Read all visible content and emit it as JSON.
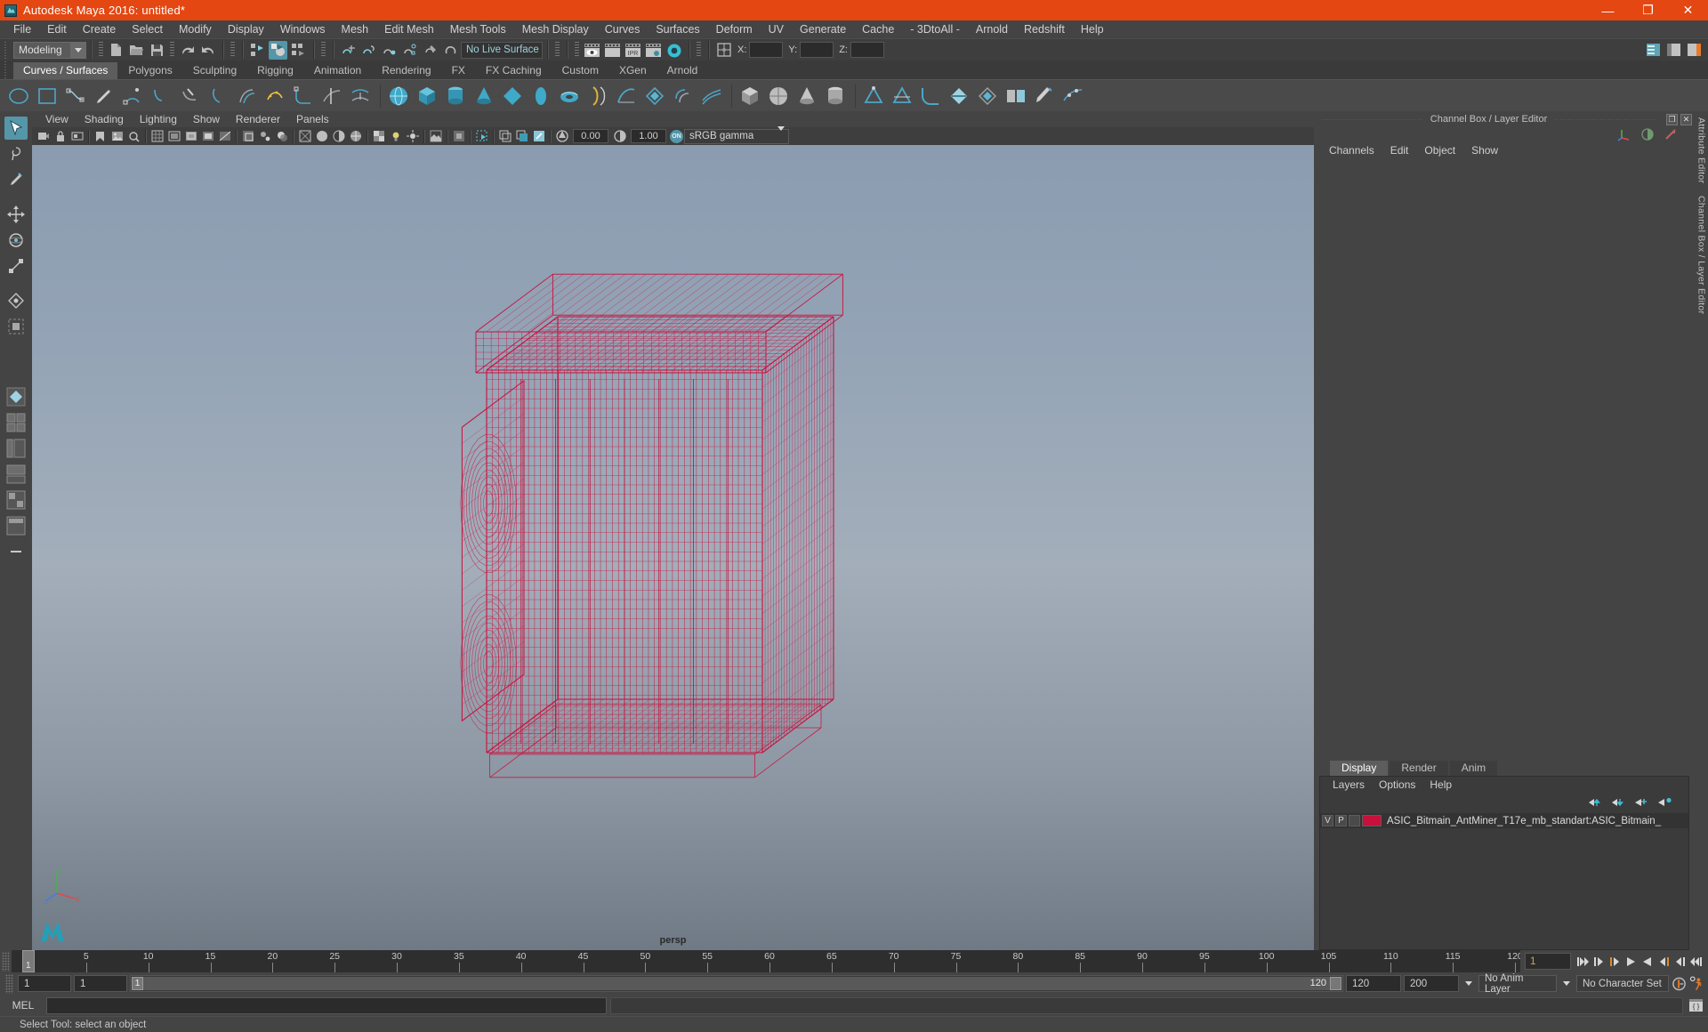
{
  "titlebar": {
    "title": "Autodesk Maya 2016: untitled*",
    "minimize": "—",
    "maximize": "❐",
    "close": "✕"
  },
  "menubar": {
    "items": [
      "File",
      "Edit",
      "Create",
      "Select",
      "Modify",
      "Display",
      "Windows",
      "Mesh",
      "Edit Mesh",
      "Mesh Tools",
      "Mesh Display",
      "Curves",
      "Surfaces",
      "Deform",
      "UV",
      "Generate",
      "Cache",
      "- 3DtoAll -",
      "Arnold",
      "Redshift",
      "Help"
    ]
  },
  "statusline": {
    "mode": "Modeling",
    "live_surface": "No Live Surface",
    "axis_x": "X:",
    "axis_y": "Y:",
    "axis_z": "Z:",
    "x_value": "",
    "y_value": "",
    "z_value": ""
  },
  "shelf": {
    "tabs": [
      "Curves / Surfaces",
      "Polygons",
      "Sculpting",
      "Rigging",
      "Animation",
      "Rendering",
      "FX",
      "FX Caching",
      "Custom",
      "XGen",
      "Arnold"
    ],
    "active_tab": "Curves / Surfaces"
  },
  "viewport": {
    "panel_menu": [
      "View",
      "Shading",
      "Lighting",
      "Show",
      "Renderer",
      "Panels"
    ],
    "exposure_value": "0.00",
    "gamma_value": "1.00",
    "color_management": "sRGB gamma",
    "cm_toggle": "ON",
    "camera_label": "persp",
    "axis_x": "x",
    "axis_y": "y",
    "axis_z": "z",
    "model_color": "#cc0e3c"
  },
  "right_panel": {
    "title": "Channel Box / Layer Editor",
    "undock": "❐",
    "close": "✕",
    "menus": [
      "Channels",
      "Edit",
      "Object",
      "Show"
    ],
    "layer_tabs": [
      "Display",
      "Render",
      "Anim"
    ],
    "active_layer_tab": "Display",
    "layer_menus": [
      "Layers",
      "Options",
      "Help"
    ],
    "layers": [
      {
        "visible": "V",
        "playback": "P",
        "color": "#c8103c",
        "name": "ASIC_Bitmain_AntMiner_T17e_mb_standart:ASIC_Bitmain_"
      }
    ],
    "vertical_tabs": [
      "Attribute Editor",
      "Channel Box / Layer Editor"
    ]
  },
  "timeline": {
    "current_frame": "1",
    "frame_field": "1",
    "ticks": [
      {
        "label": "5",
        "frame": 5
      },
      {
        "label": "10",
        "frame": 10
      },
      {
        "label": "15",
        "frame": 15
      },
      {
        "label": "20",
        "frame": 20
      },
      {
        "label": "25",
        "frame": 25
      },
      {
        "label": "30",
        "frame": 30
      },
      {
        "label": "35",
        "frame": 35
      },
      {
        "label": "40",
        "frame": 40
      },
      {
        "label": "45",
        "frame": 45
      },
      {
        "label": "50",
        "frame": 50
      },
      {
        "label": "55",
        "frame": 55
      },
      {
        "label": "60",
        "frame": 60
      },
      {
        "label": "65",
        "frame": 65
      },
      {
        "label": "70",
        "frame": 70
      },
      {
        "label": "75",
        "frame": 75
      },
      {
        "label": "80",
        "frame": 80
      },
      {
        "label": "85",
        "frame": 85
      },
      {
        "label": "90",
        "frame": 90
      },
      {
        "label": "95",
        "frame": 95
      },
      {
        "label": "100",
        "frame": 100
      },
      {
        "label": "105",
        "frame": 105
      },
      {
        "label": "110",
        "frame": 110
      },
      {
        "label": "115",
        "frame": 115
      },
      {
        "label": "120",
        "frame": 120
      }
    ],
    "range_start": "1",
    "range_start_inner": "1",
    "range_end_inner": "120",
    "range_end": "120",
    "playback_end": "200",
    "anim_layer": "No Anim Layer",
    "character_set": "No Character Set"
  },
  "commandline": {
    "label": "MEL",
    "input_value": "",
    "output_value": ""
  },
  "statusbar": {
    "message": "Select Tool: select an object"
  }
}
